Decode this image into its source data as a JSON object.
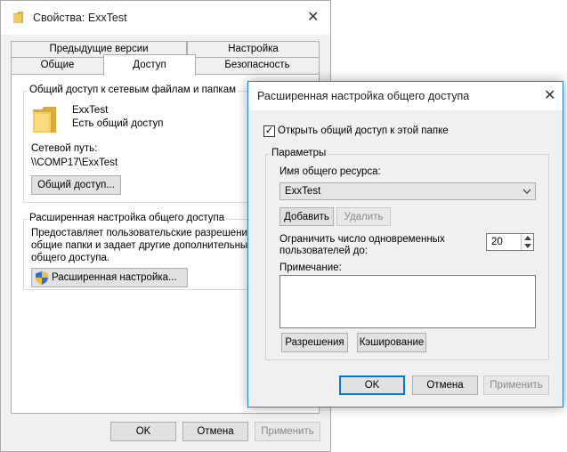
{
  "props_window": {
    "title": "Свойства: ExxTest",
    "tabs_row1": [
      "Предыдущие версии",
      "Настройка"
    ],
    "tabs_row2": [
      "Общие",
      "Доступ",
      "Безопасность"
    ],
    "share_group_title": "Общий доступ к сетевым файлам и папкам",
    "folder_name": "ExxTest",
    "folder_status": "Есть общий доступ",
    "network_path_label": "Сетевой путь:",
    "network_path": "\\\\COMP17\\ExxTest",
    "share_button": "Общий доступ...",
    "advanced_group_title": "Расширенная настройка общего доступа",
    "advanced_desc_1": "Предоставляет пользовательские разрешения,",
    "advanced_desc_2": "общие папки и задает другие дополнительные п",
    "advanced_desc_3": "общего доступа.",
    "advanced_button": "Расширенная настройка...",
    "ok": "OK",
    "cancel": "Отмена",
    "apply": "Применить"
  },
  "advanced_dialog": {
    "title": "Расширенная настройка общего доступа",
    "share_checkbox_label": "Открыть общий доступ к этой папке",
    "share_checked": true,
    "params_title": "Параметры",
    "share_name_label": "Имя общего ресурса:",
    "share_name_value": "ExxTest",
    "add_button": "Добавить",
    "remove_button": "Удалить",
    "limit_label_1": "Ограничить число одновременных",
    "limit_label_2": "пользователей до:",
    "limit_value": "20",
    "note_label": "Примечание:",
    "note_value": "",
    "permissions_button": "Разрешения",
    "caching_button": "Кэширование",
    "ok": "OK",
    "cancel": "Отмена",
    "apply": "Применить"
  },
  "icons": {
    "folder": "folder-icon",
    "shield": "uac-shield-icon",
    "close": "close-icon"
  },
  "colors": {
    "accent": "#0078d7",
    "dialog_border": "#1883d7",
    "folder_yellow": "#f2c24f"
  }
}
